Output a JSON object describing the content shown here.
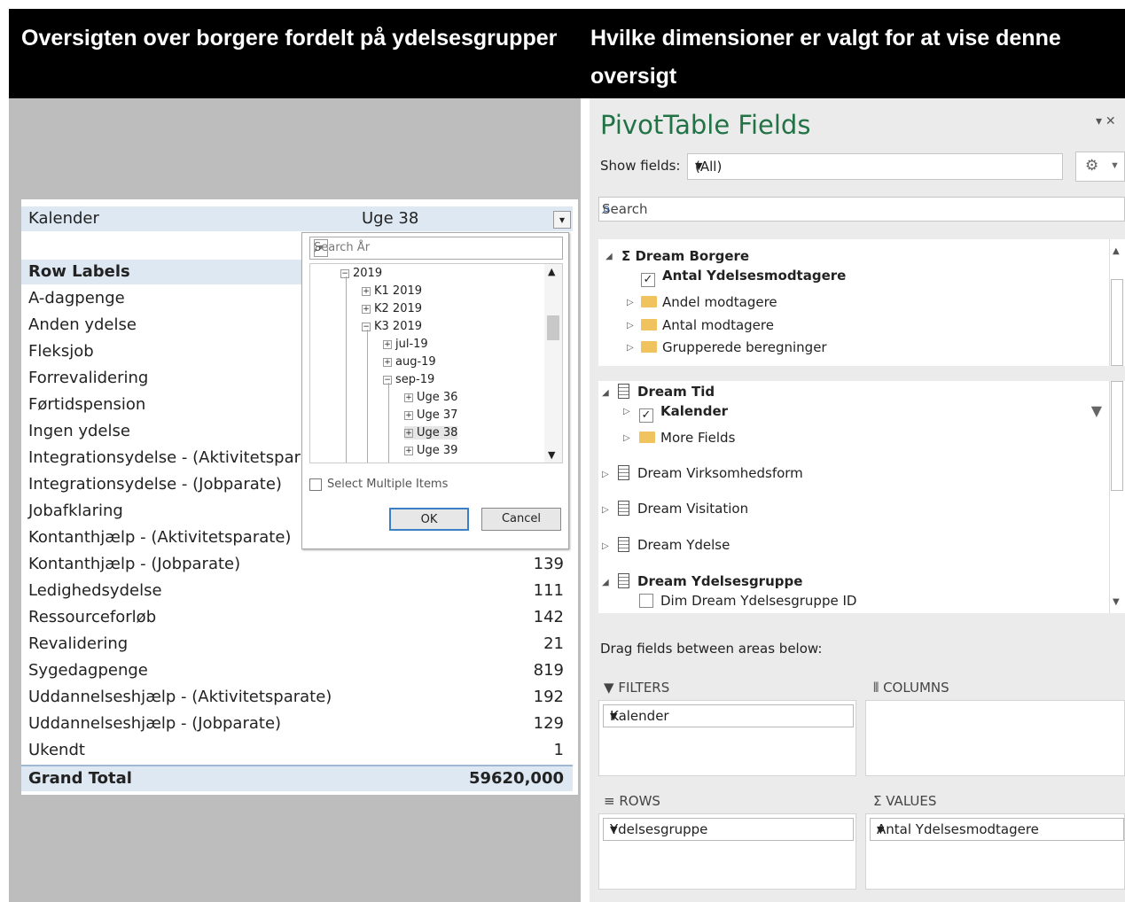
{
  "headers": {
    "left": "Oversigten over borgere fordelt på ydelsesgrupper",
    "right": "Hvilke dimensioner er valgt for at vise denne oversigt"
  },
  "pivot": {
    "filter_label": "Kalender",
    "filter_value": "Uge 38",
    "row_labels": "Row Labels",
    "rows": [
      {
        "name": "A-dagpenge",
        "value": ""
      },
      {
        "name": "Anden ydelse",
        "value": ""
      },
      {
        "name": "Fleksjob",
        "value": ""
      },
      {
        "name": "Forrevalidering",
        "value": ""
      },
      {
        "name": "Førtidspension",
        "value": ""
      },
      {
        "name": "Ingen ydelse",
        "value": ""
      },
      {
        "name": "Integrationsydelse - (Aktivitetspar",
        "value": ""
      },
      {
        "name": "Integrationsydelse - (Jobparate)",
        "value": ""
      },
      {
        "name": "Jobafklaring",
        "value": ""
      },
      {
        "name": "Kontanthjælp - (Aktivitetsparate)",
        "value": ""
      },
      {
        "name": "Kontanthjælp - (Jobparate)",
        "value": "139"
      },
      {
        "name": "Ledighedsydelse",
        "value": "111"
      },
      {
        "name": "Ressourceforløb",
        "value": "142"
      },
      {
        "name": "Revalidering",
        "value": "21"
      },
      {
        "name": "Sygedagpenge",
        "value": "819"
      },
      {
        "name": "Uddannelseshjælp - (Aktivitetsparate)",
        "value": "192"
      },
      {
        "name": "Uddannelseshjælp - (Jobparate)",
        "value": "129"
      },
      {
        "name": "Ukendt",
        "value": "1"
      }
    ],
    "grand_total_label": "Grand Total",
    "grand_total_value": "59620,000"
  },
  "popup": {
    "search_placeholder": "Search År",
    "tree": [
      "2019",
      "K1 2019",
      "K2 2019",
      "K3 2019",
      "jul-19",
      "aug-19",
      "sep-19",
      "Uge 36",
      "Uge 37",
      "Uge 38",
      "Uge 39"
    ],
    "select_multiple": "Select Multiple Items",
    "ok": "OK",
    "cancel": "Cancel"
  },
  "fields_pane": {
    "title": "PivotTable Fields",
    "show_fields_label": "Show fields:",
    "show_fields_value": "(All)",
    "search_placeholder": "Search",
    "group1": {
      "name": "Dream Borgere",
      "items": [
        "Antal Ydelsesmodtagere",
        "Andel modtagere",
        "Antal modtagere",
        "Grupperede beregninger"
      ]
    },
    "group2": {
      "tid": "Dream Tid",
      "kalender": "Kalender",
      "more_fields": "More Fields",
      "virksomhedsform": "Dream Virksomhedsform",
      "visitation": "Dream Visitation",
      "ydelse": "Dream Ydelse",
      "ydelsesgruppe": "Dream Ydelsesgruppe",
      "dim_id": "Dim Dream Ydelsesgruppe ID"
    },
    "drag_label": "Drag fields between areas below:",
    "areas": {
      "filters": "FILTERS",
      "columns": "COLUMNS",
      "rows": "ROWS",
      "values": "VALUES",
      "filters_chip": "Kalender",
      "rows_chip": "Ydelsesgruppe",
      "values_chip": "Antal Ydelsesmodtagere"
    }
  },
  "colors": {
    "accent_green": "#217346",
    "pivot_header": "#dde8f3"
  }
}
